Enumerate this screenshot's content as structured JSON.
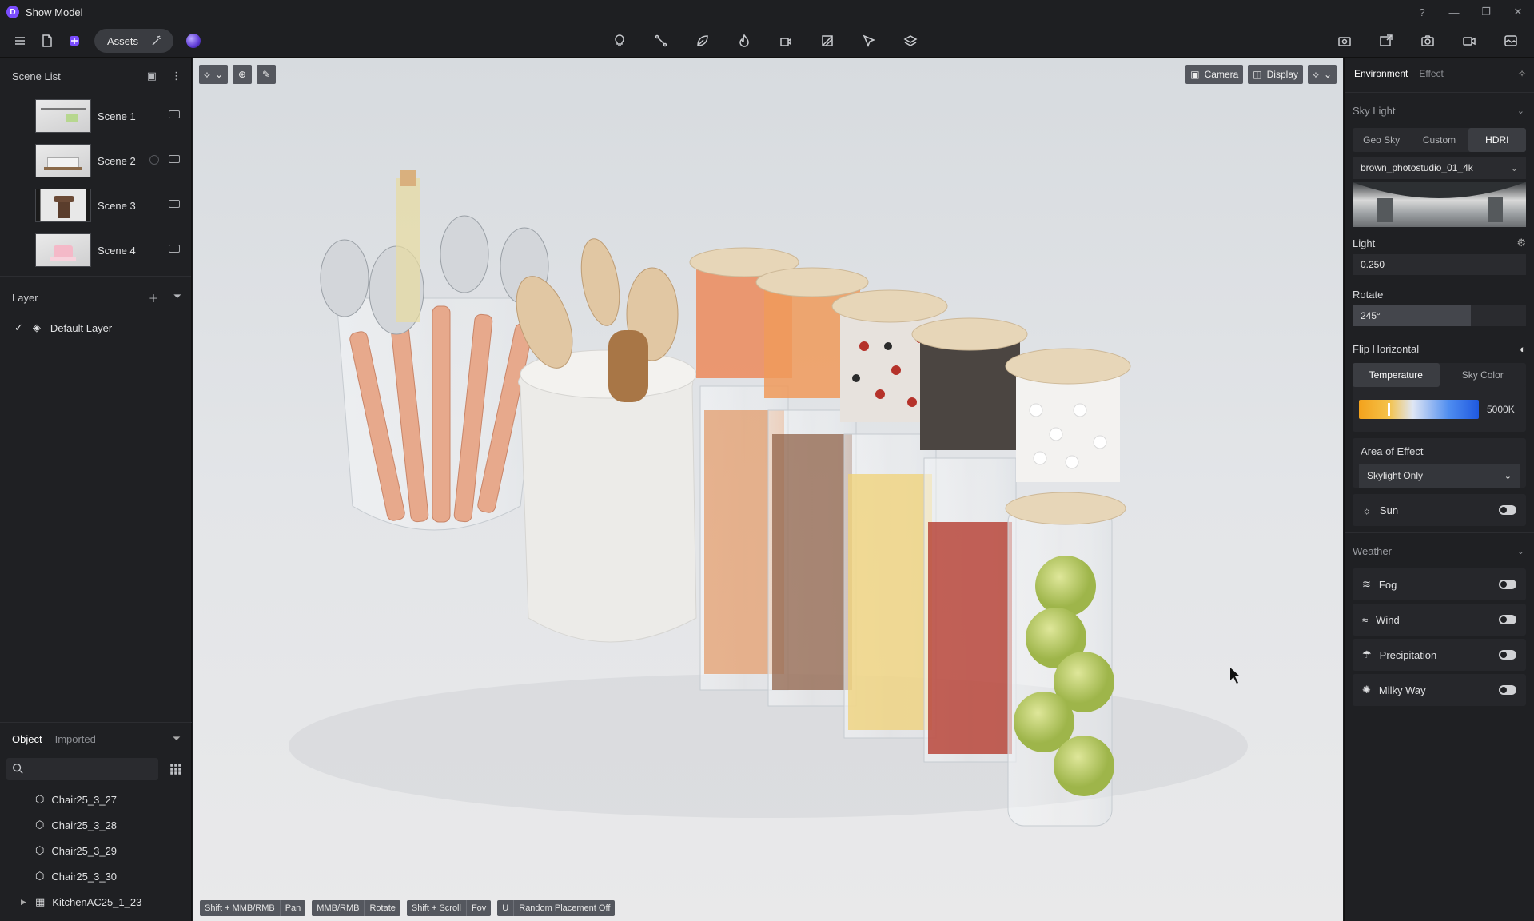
{
  "app": {
    "title": "Show Model",
    "logo_letter": "D"
  },
  "window_controls": [
    "?",
    "—",
    "❐",
    "✕"
  ],
  "toolbar": {
    "assets_label": "Assets"
  },
  "scene_list": {
    "title": "Scene List",
    "scenes": [
      {
        "label": "Scene 1"
      },
      {
        "label": "Scene 2"
      },
      {
        "label": "Scene 3"
      },
      {
        "label": "Scene 4"
      }
    ]
  },
  "layer": {
    "title": "Layer",
    "items": [
      {
        "label": "Default Layer"
      }
    ]
  },
  "objects": {
    "tabs": [
      "Object",
      "Imported"
    ],
    "search_placeholder": "",
    "items": [
      {
        "label": "Chair25_3_27"
      },
      {
        "label": "Chair25_3_28"
      },
      {
        "label": "Chair25_3_29"
      },
      {
        "label": "Chair25_3_30"
      },
      {
        "label": "KitchenAC25_1_23"
      }
    ]
  },
  "viewport": {
    "camera_label": "Camera",
    "display_label": "Display",
    "hints": [
      {
        "key": "Shift + MMB/RMB",
        "action": "Pan"
      },
      {
        "key": "MMB/RMB",
        "action": "Rotate"
      },
      {
        "key": "Shift + Scroll",
        "action": "Fov"
      },
      {
        "key": "U",
        "action": "Random Placement Off"
      }
    ]
  },
  "environment": {
    "tabs": [
      "Environment",
      "Effect"
    ],
    "sky_light": {
      "title": "Sky Light",
      "modes": [
        "Geo Sky",
        "Custom",
        "HDRI"
      ],
      "hdri_name": "brown_photostudio_01_4k",
      "light_label": "Light",
      "light_value": "0.250",
      "rotate_label": "Rotate",
      "rotate_value": "245°",
      "rotate_fraction": 0.68,
      "flip_label": "Flip Horizontal",
      "color_tabs": [
        "Temperature",
        "Sky Color"
      ],
      "temperature_value": "5000K",
      "temperature_fraction": 0.24,
      "area_label": "Area of Effect",
      "area_value": "Skylight Only",
      "sun_label": "Sun"
    },
    "weather": {
      "title": "Weather",
      "items": [
        {
          "label": "Fog"
        },
        {
          "label": "Wind"
        },
        {
          "label": "Precipitation"
        },
        {
          "label": "Milky Way"
        }
      ]
    }
  }
}
